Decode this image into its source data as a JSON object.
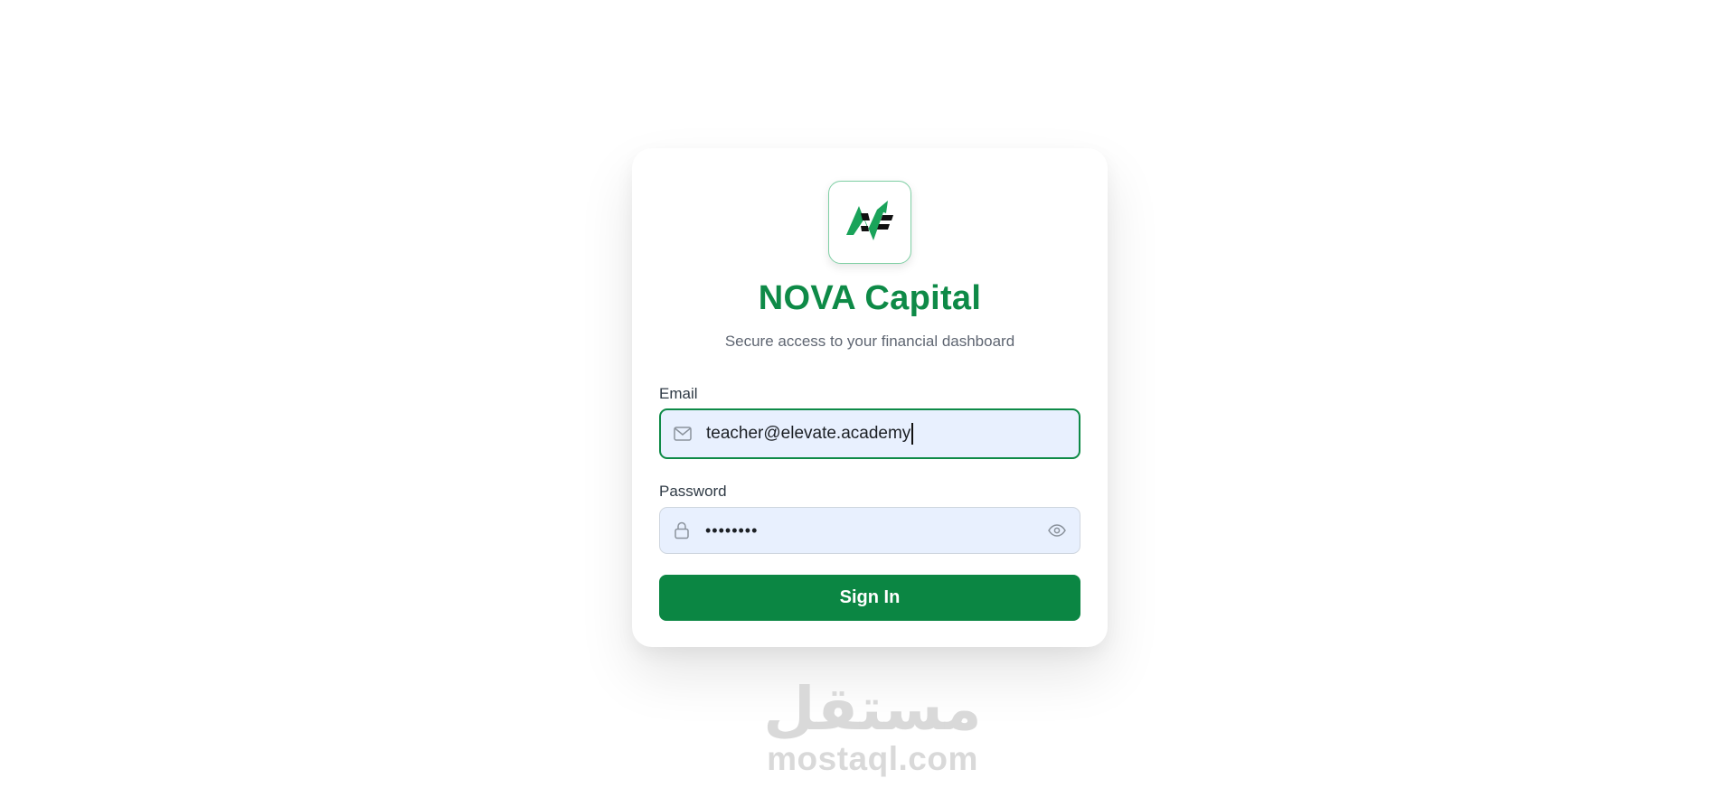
{
  "brand": {
    "title": "NOVA Capital",
    "subtitle": "Secure access to your financial dashboard",
    "accent_color": "#0e8a47",
    "logo_icon": "nova-logo-icon"
  },
  "form": {
    "email": {
      "label": "Email",
      "value": "teacher@elevate.academy",
      "icon": "mail-icon",
      "focused": true
    },
    "password": {
      "label": "Password",
      "value": "••••••••",
      "icon": "lock-icon",
      "toggle_icon": "eye-icon"
    },
    "submit_label": "Sign In",
    "button_color": "#0b8643"
  },
  "watermark": {
    "arabic": "مستقل",
    "latin": "mostaql.com"
  }
}
